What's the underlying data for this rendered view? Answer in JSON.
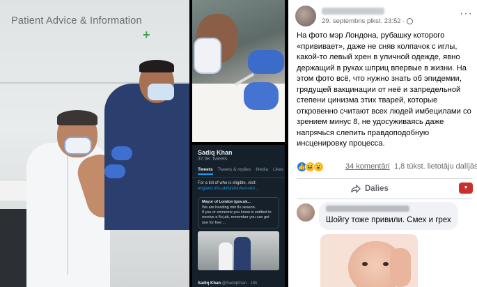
{
  "left_photo": {
    "sign_text": "Patient Advice & Information",
    "sign_plus": "+"
  },
  "twitter": {
    "profile_name": "Sadiq Khan",
    "tweet_count": "37.5K Tweets",
    "tabs": [
      "Tweets",
      "Tweets & replies",
      "Media",
      "Likes"
    ],
    "body_text": "For a list of who is eligible, visit:",
    "body_link": "england.nhs.uk/london/our-wor...",
    "quote_name": "Mayor of London (gov.uk...",
    "quote_line1": "We are heading into flu season.",
    "quote_line2": "If you or someone you know is entitled to receive a flu jab, remember you can get one for free ...",
    "footer_name": "Sadiq Khan",
    "footer_handle": "@SadiqKhan · 18h"
  },
  "post": {
    "timestamp": "29. septembris plkst. 23:52 ·",
    "menu": "···",
    "text": "На фото мэр Лондона, рубашку которого «прививает», даже не сняв колпачок с иглы, какой-то левый хрен в уличной одежде, явно держащий в руках шприц впервые в жизни. На этом фото всё, что нужно знать об эпидемии, грядущей вакцинации от неё и запредельной степени цинизма этих тварей, которые откровенно считают всех людей имбецилами со зрением минус 8, не удосуживаясь даже напрячься слепить правдоподобную инсценировку процесса.",
    "reaction_icons": [
      "like-icon",
      "laugh-icon",
      "wow-icon"
    ],
    "comments": "34 komentāri",
    "shares": "1,8 tūkst. lietotāju dalījās",
    "share_label": "Dalies",
    "comment_text": "Шойгу тоже привили. Смех и грех"
  },
  "colors": {
    "accent": "#1877f2",
    "twitter_bg": "#15202b",
    "twitter_link": "#1d9bf0",
    "meta_text": "#65676b"
  }
}
